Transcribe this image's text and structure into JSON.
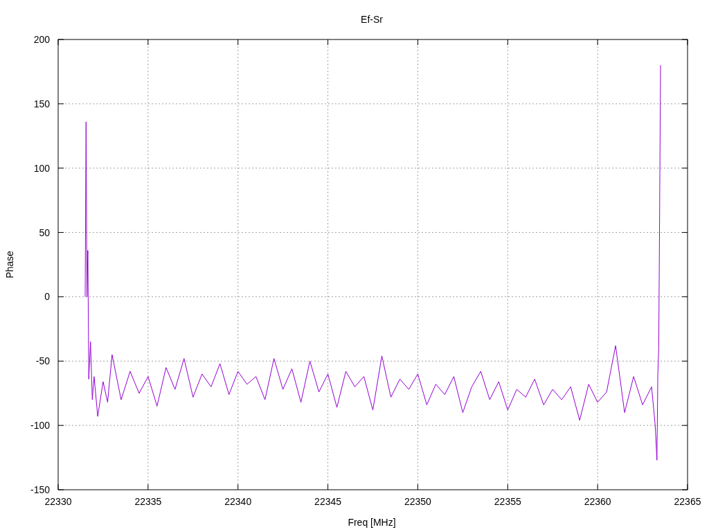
{
  "chart_data": {
    "type": "line",
    "grid": true,
    "title": "Ef-Sr",
    "xlabel": "Freq [MHz]",
    "ylabel": "Phase",
    "xlim": [
      22330,
      22365
    ],
    "ylim": [
      -150,
      200
    ],
    "xticks": [
      22330,
      22335,
      22340,
      22345,
      22350,
      22355,
      22360,
      22365
    ],
    "yticks": [
      -150,
      -100,
      -50,
      0,
      50,
      100,
      150,
      200
    ],
    "x": [
      22331.5,
      22331.55,
      22331.6,
      22331.65,
      22331.7,
      22331.8,
      22331.9,
      22332,
      22332.2,
      22332.5,
      22332.75,
      22333,
      22333.5,
      22334,
      22334.5,
      22335,
      22335.5,
      22336,
      22336.5,
      22337,
      22337.5,
      22338,
      22338.5,
      22339,
      22339.5,
      22340,
      22340.5,
      22341,
      22341.5,
      22342,
      22342.5,
      22343,
      22343.5,
      22344,
      22344.5,
      22345,
      22345.5,
      22346,
      22346.5,
      22347,
      22347.5,
      22348,
      22348.5,
      22349,
      22349.5,
      22350,
      22350.5,
      22351,
      22351.5,
      22352,
      22352.5,
      22353,
      22353.5,
      22354,
      22354.5,
      22355,
      22355.5,
      22356,
      22356.5,
      22357,
      22357.5,
      22358,
      22358.5,
      22359,
      22359.5,
      22360,
      22360.5,
      22361,
      22361.5,
      22362,
      22362.5,
      22363,
      22363.2,
      22363.3,
      22363.35,
      22363.4,
      22363.45,
      22363.5
    ],
    "series": [
      {
        "color": "#9400d3",
        "values": [
          0,
          136,
          0,
          36,
          -64,
          -35,
          -80,
          -62,
          -93,
          -66,
          -82,
          -45,
          -80,
          -58,
          -75,
          -62,
          -85,
          -55,
          -72,
          -48,
          -78,
          -60,
          -70,
          -52,
          -76,
          -58,
          -68,
          -62,
          -80,
          -48,
          -72,
          -56,
          -82,
          -50,
          -74,
          -60,
          -86,
          -58,
          -70,
          -62,
          -88,
          -46,
          -78,
          -64,
          -72,
          -60,
          -84,
          -68,
          -76,
          -62,
          -90,
          -70,
          -58,
          -80,
          -66,
          -88,
          -72,
          -78,
          -64,
          -84,
          -72,
          -80,
          -70,
          -96,
          -68,
          -82,
          -74,
          -38,
          -90,
          -62,
          -84,
          -70,
          -100,
          -127,
          -60,
          -40,
          66,
          180
        ]
      }
    ]
  }
}
